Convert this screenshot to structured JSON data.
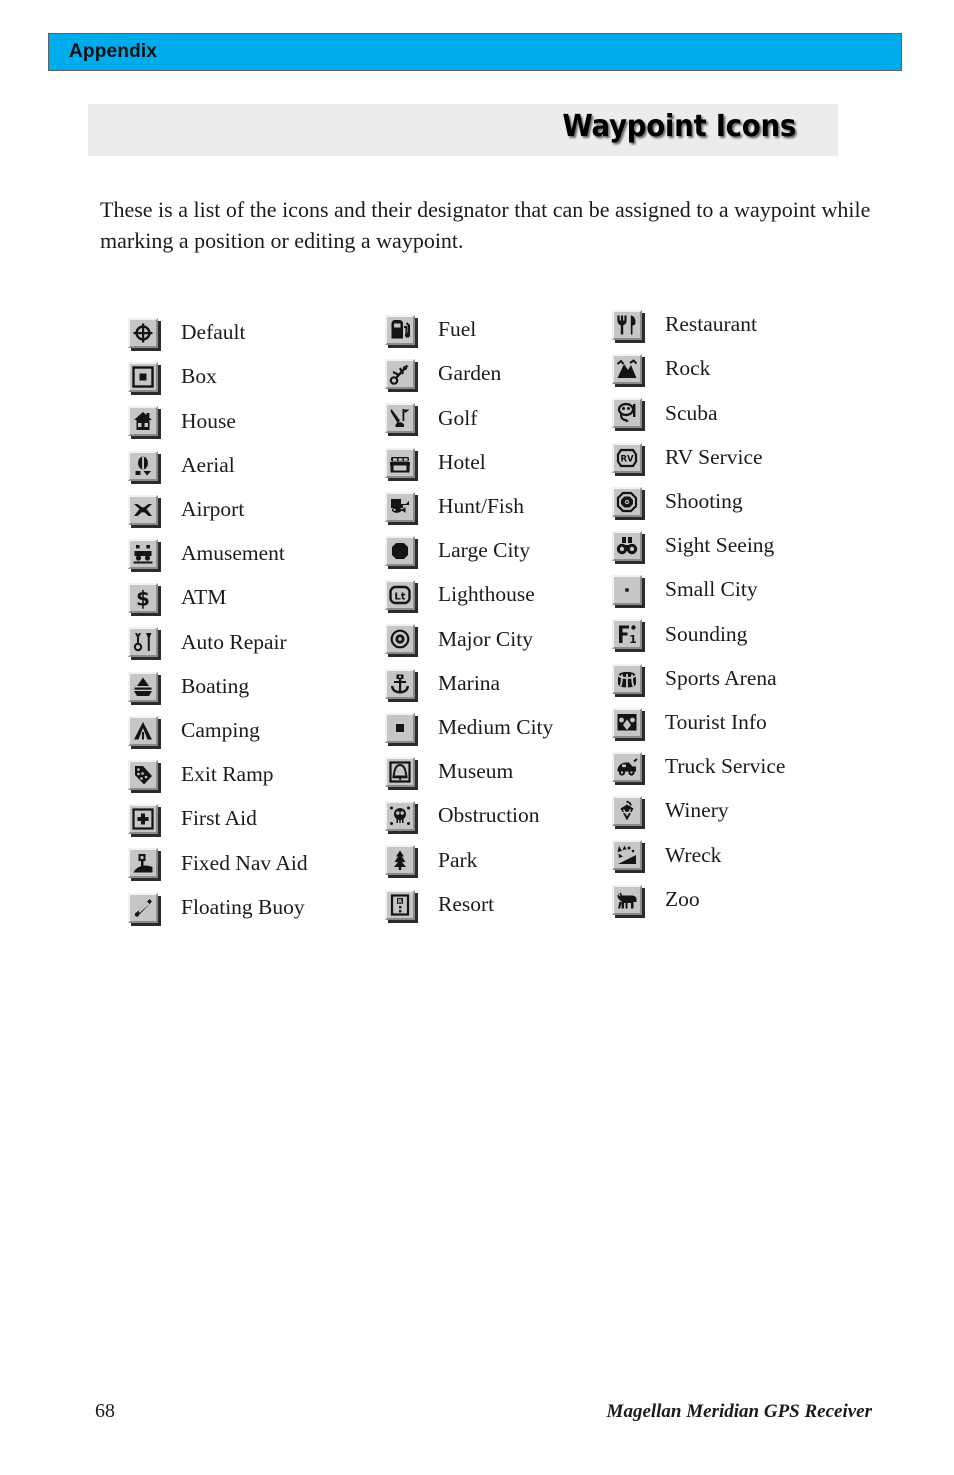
{
  "header": {
    "section_label": "Appendix",
    "bar_color": "#00ABEC"
  },
  "title": {
    "text": "Waypoint Icons",
    "band_color": "#ececec"
  },
  "intro": {
    "paragraph": "These is a list of the icons and their designator that can be assigned to a waypoint while marking a position or editing a waypoint."
  },
  "icon_columns": [
    {
      "items": [
        {
          "label": "Default",
          "icon": "crosshair-target-icon"
        },
        {
          "label": "Box",
          "icon": "concentric-square-icon"
        },
        {
          "label": "House",
          "icon": "house-icon"
        },
        {
          "label": "Aerial",
          "icon": "aerial-tower-icon"
        },
        {
          "label": "Airport",
          "icon": "airplane-icon"
        },
        {
          "label": "Amusement",
          "icon": "amusement-ride-icon"
        },
        {
          "label": "ATM",
          "icon": "dollar-sign-icon"
        },
        {
          "label": "Auto Repair",
          "icon": "wrench-screwdriver-icon"
        },
        {
          "label": "Boating",
          "icon": "sailboat-icon"
        },
        {
          "label": "Camping",
          "icon": "tent-icon"
        },
        {
          "label": "Exit Ramp",
          "icon": "exit-ramp-icon"
        },
        {
          "label": "First Aid",
          "icon": "medical-cross-icon"
        },
        {
          "label": "Fixed Nav Aid",
          "icon": "fixed-nav-aid-icon"
        },
        {
          "label": "Floating Buoy",
          "icon": "floating-buoy-icon"
        }
      ]
    },
    {
      "items": [
        {
          "label": "Fuel",
          "icon": "fuel-pump-icon"
        },
        {
          "label": "Garden",
          "icon": "garden-flower-icon"
        },
        {
          "label": "Golf",
          "icon": "golf-club-flag-icon"
        },
        {
          "label": "Hotel",
          "icon": "hotel-bed-icon"
        },
        {
          "label": "Hunt/Fish",
          "icon": "hunt-fish-icon"
        },
        {
          "label": "Large City",
          "icon": "large-city-octagon-icon"
        },
        {
          "label": "Lighthouse",
          "icon": "lighthouse-lt-icon"
        },
        {
          "label": "Major City",
          "icon": "major-city-ring-icon"
        },
        {
          "label": "Marina",
          "icon": "anchor-icon"
        },
        {
          "label": "Medium City",
          "icon": "medium-city-square-icon"
        },
        {
          "label": "Museum",
          "icon": "museum-bell-icon"
        },
        {
          "label": "Obstruction",
          "icon": "obstruction-skull-icon"
        },
        {
          "label": "Park",
          "icon": "park-tree-icon"
        },
        {
          "label": "Resort",
          "icon": "resort-building-icon"
        }
      ]
    },
    {
      "items": [
        {
          "label": "Restaurant",
          "icon": "fork-knife-icon"
        },
        {
          "label": "Rock",
          "icon": "rock-icon"
        },
        {
          "label": "Scuba",
          "icon": "scuba-mask-icon"
        },
        {
          "label": "RV Service",
          "icon": "rv-service-icon"
        },
        {
          "label": "Shooting",
          "icon": "shooting-target-icon"
        },
        {
          "label": "Sight Seeing",
          "icon": "binoculars-icon"
        },
        {
          "label": "Small City",
          "icon": "small-city-dot-icon"
        },
        {
          "label": "Sounding",
          "icon": "sounding-depth-icon"
        },
        {
          "label": "Sports Arena",
          "icon": "sports-arena-icon"
        },
        {
          "label": "Tourist Info",
          "icon": "tourist-info-icon"
        },
        {
          "label": "Truck Service",
          "icon": "truck-icon"
        },
        {
          "label": "Winery",
          "icon": "grapes-icon"
        },
        {
          "label": "Wreck",
          "icon": "wreck-icon"
        },
        {
          "label": "Zoo",
          "icon": "zoo-animal-icon"
        }
      ]
    }
  ],
  "footer": {
    "page_number": "68",
    "document_title": "Magellan Meridian GPS Receiver"
  }
}
